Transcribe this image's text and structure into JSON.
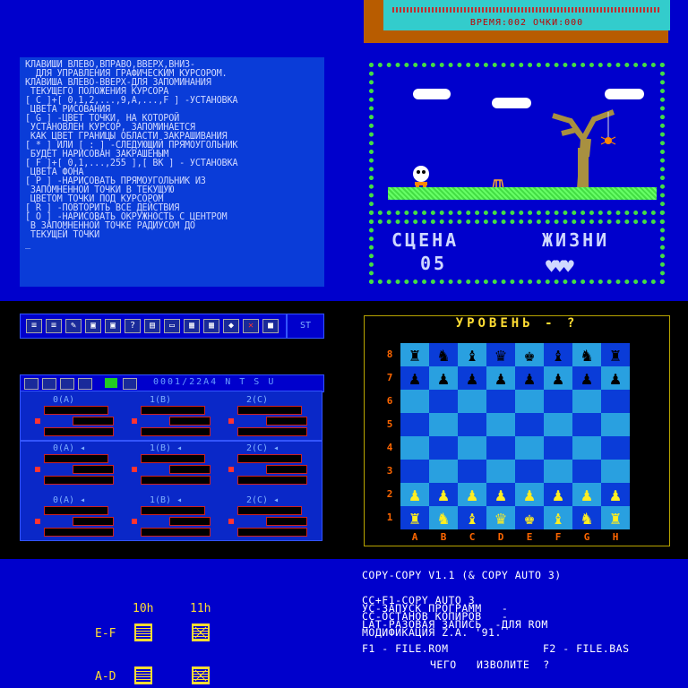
{
  "help_panel": {
    "lines": [
      "КЛАВИШИ ВЛЕВО,ВПРАВО,ВВЕРХ,ВНИЗ-",
      "  ДЛЯ УПРАВЛЕНИЯ ГРАФИЧЕСКИМ КУРСОРОМ.",
      "КЛАВИША ВЛЕВО-ВВЕРХ-ДЛЯ ЗАПОМИНАНИЯ",
      " ТЕКУЩЕГО ПОЛОЖЕНИЯ КУРСОРА",
      "[ C ]+[ 0,1,2,...,9,A,...,F ] -УСТАНОВКА",
      " ЦВЕТА РИСОВАНИЯ",
      "[ G ] -ЦВЕТ ТОЧКИ, НА КОТОРОЙ",
      " УСТАНОВЛЕН КУРСОР, ЗАПОМИНАЕТСЯ",
      " КАК ЦВЕТ ГРАНИЦЫ ОБЛАСТИ ЗАКРАШИВАНИЯ",
      "[ * ] ИЛИ [ : ] -СЛЕДУЮЩИЙ ПРЯМОУГОЛЬНИК",
      " БУДЕТ НАРИСОВАН ЗАКРАШЕНЫМ",
      "[ F ]+[ 0,1,...,255 ],[ ВК ] - УСТАНОВКА",
      " ЦВЕТА ФОНА",
      "[ P ] -НАРИСОВАТЬ ПРЯМОУГОЛЬНИК ИЗ",
      " ЗАПОМНЕННОЙ ТОЧКИ В ТЕКУЩУЮ",
      " ЦВЕТОМ ТОЧКИ ПОД КУРСОРОМ",
      "[ R ] -ПОВТОРИТЬ ВСЕ ДЕЙСТВИЯ",
      "[ O ] -НАРИСОВАТЬ ОКРУЖНОСТЬ С ЦЕНТРОМ",
      " В ЗАПОМНЕННОЙ ТОЧКЕ РАДИУСОМ ДО",
      " ТЕКУЩЕЙ ТОЧКИ",
      "_"
    ]
  },
  "game": {
    "stats_line": "ВРЕМЯ:002 ОЧКИ:000",
    "scene_label": "СЦЕНА",
    "scene_value": "05",
    "lives_label": "ЖИЗНИ",
    "lives": 3
  },
  "tracker": {
    "toolbar_icons": [
      "list",
      "list",
      "pencil",
      "disk",
      "disk",
      "?",
      "file",
      "monitor",
      "grid",
      "grid",
      "diamond",
      "close",
      "square"
    ],
    "st_button": "ST",
    "status": "0001/22A4 N T S U",
    "channels_row1": [
      "0(A)",
      "1(B)",
      "2(C)"
    ],
    "channels_row2": [
      "0(A)",
      "1(B)",
      "2(C)"
    ],
    "channels_row3": [
      "0(A)",
      "1(B)",
      "2(C)"
    ]
  },
  "chess": {
    "title": "УРОВЕНЬ - ?",
    "ranks": [
      "8",
      "7",
      "6",
      "5",
      "4",
      "3",
      "2",
      "1"
    ],
    "files": [
      "A",
      "B",
      "C",
      "D",
      "E",
      "F",
      "G",
      "H"
    ],
    "black_back": [
      "♜",
      "♞",
      "♝",
      "♛",
      "♚",
      "♝",
      "♞",
      "♜"
    ],
    "black_pawns": [
      "♟",
      "♟",
      "♟",
      "♟",
      "♟",
      "♟",
      "♟",
      "♟"
    ],
    "white_pawns": [
      "♟",
      "♟",
      "♟",
      "♟",
      "♟",
      "♟",
      "♟",
      "♟"
    ],
    "white_back": [
      "♜",
      "♞",
      "♝",
      "♛",
      "♚",
      "♝",
      "♞",
      "♜"
    ]
  },
  "banks": {
    "col1": "10h",
    "col2": "11h",
    "row1": "E-F",
    "row2": "A-D"
  },
  "copy_panel": {
    "title": "COPY-COPY V1.1 (& COPY AUTO 3)",
    "lines": [
      "CC+F1-COPY AUTO 3",
      "УС-ЗАПУСК ПРОГРАММ   -",
      "CC-ОСТАНОВ КОПИРОВ   -",
      "LAT-РАЗОВАЯ ЗАПИСЬ  -ДЛЯ ROM",
      "МОДИФИКАЦИЯ Z.A. '91."
    ],
    "f1": "F1 - FILE.ROM",
    "f2": "F2 - FILE.BAS",
    "prompt": "ЧЕГО   ИЗВОЛИТЕ  ?"
  }
}
